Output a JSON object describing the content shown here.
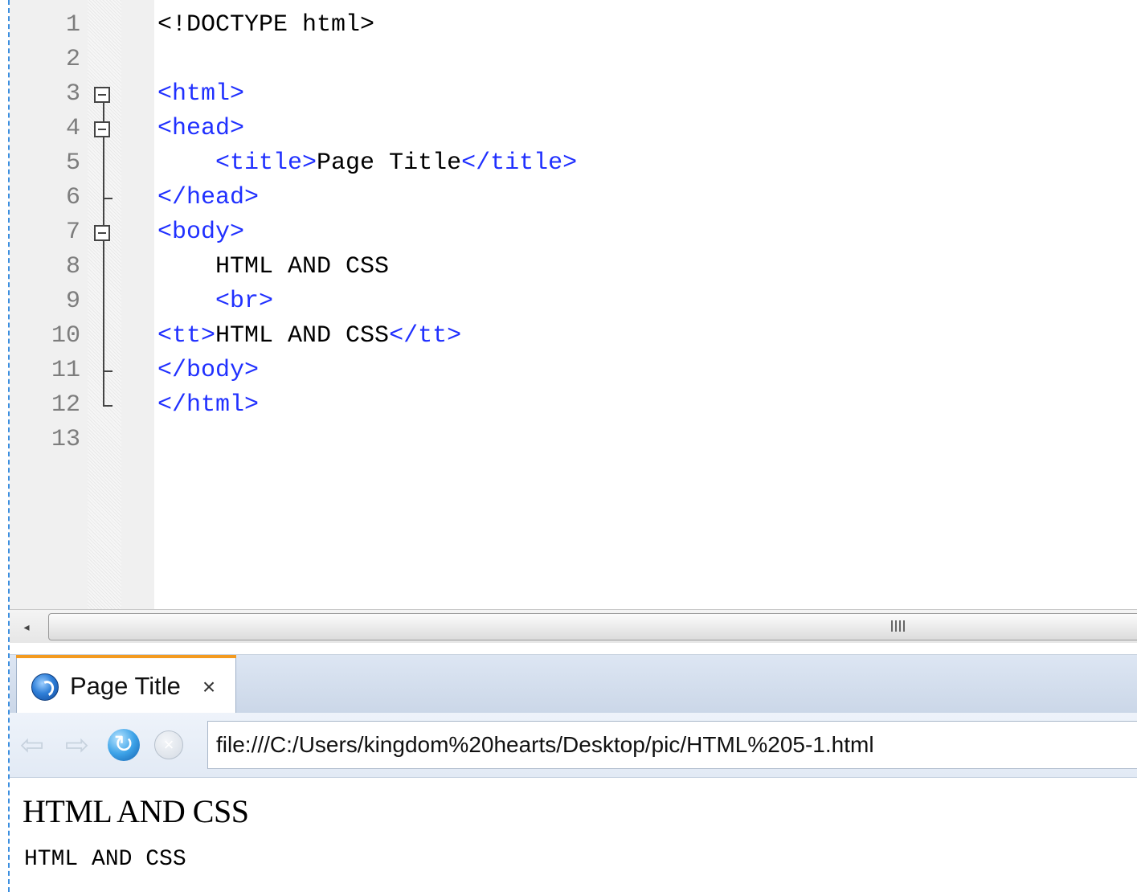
{
  "editor": {
    "lines": [
      {
        "num": "1",
        "parts": [
          {
            "t": "<!DOCTYPE html>",
            "k": "text"
          }
        ]
      },
      {
        "num": "2",
        "parts": []
      },
      {
        "num": "3",
        "parts": [
          {
            "t": "<html>",
            "k": "tag"
          }
        ]
      },
      {
        "num": "4",
        "parts": [
          {
            "t": "<head>",
            "k": "tag"
          }
        ]
      },
      {
        "num": "5",
        "parts": [
          {
            "t": "    ",
            "k": "text"
          },
          {
            "t": "<title>",
            "k": "tag"
          },
          {
            "t": "Page Title",
            "k": "text"
          },
          {
            "t": "</title>",
            "k": "tag"
          }
        ]
      },
      {
        "num": "6",
        "parts": [
          {
            "t": "</head>",
            "k": "tag"
          }
        ]
      },
      {
        "num": "7",
        "parts": [
          {
            "t": "<body>",
            "k": "tag"
          }
        ]
      },
      {
        "num": "8",
        "parts": [
          {
            "t": "    HTML AND CSS",
            "k": "text"
          }
        ]
      },
      {
        "num": "9",
        "parts": [
          {
            "t": "    ",
            "k": "text"
          },
          {
            "t": "<br>",
            "k": "tag"
          }
        ]
      },
      {
        "num": "10",
        "parts": [
          {
            "t": "<tt>",
            "k": "tag"
          },
          {
            "t": "HTML AND CSS",
            "k": "text"
          },
          {
            "t": "</tt>",
            "k": "tag"
          }
        ]
      },
      {
        "num": "11",
        "parts": [
          {
            "t": "</body>",
            "k": "tag"
          }
        ]
      },
      {
        "num": "12",
        "parts": [
          {
            "t": "</html>",
            "k": "tag"
          }
        ]
      },
      {
        "num": "13",
        "parts": []
      }
    ],
    "folds": [
      {
        "line": "3",
        "kind": "collapse-box"
      },
      {
        "line": "4",
        "kind": "collapse-box"
      },
      {
        "line": "6",
        "kind": "branch-end"
      },
      {
        "line": "7",
        "kind": "collapse-box"
      },
      {
        "line": "11",
        "kind": "branch-end"
      },
      {
        "line": "12",
        "kind": "final-end"
      }
    ],
    "scrollbar": {
      "left_arrow": "◂",
      "grip_icon": "grip-icon"
    }
  },
  "browser": {
    "tab": {
      "title": "Page Title",
      "close": "×",
      "icon": "globe-icon"
    },
    "nav": {
      "back": "⇦",
      "forward": "⇨",
      "reload": "↻",
      "stop": "×"
    },
    "url": "file:///C:/Users/kingdom%20hearts/Desktop/pic/HTML%205-1.html",
    "page": {
      "line1": "HTML AND CSS",
      "line2": "HTML AND CSS"
    }
  },
  "colors": {
    "tag": "#2030ff",
    "text": "#000000",
    "line_number": "#7d7d7d",
    "tab_accent": "#f39a1f"
  }
}
